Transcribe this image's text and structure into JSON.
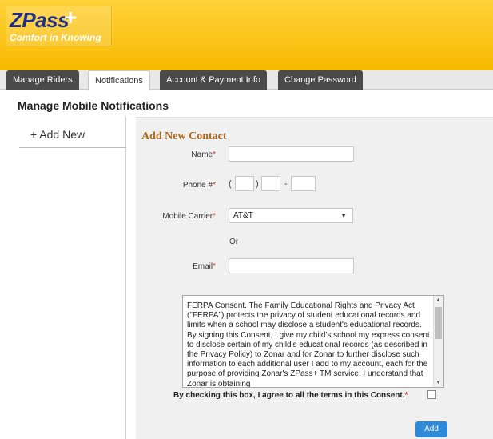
{
  "brand": {
    "name": "ZPass",
    "plus": "+",
    "tagline": "Comfort in Knowing",
    "header_color": "#f7b900"
  },
  "tabs": [
    {
      "label": "Manage Riders"
    },
    {
      "label": "Notifications"
    },
    {
      "label": "Account & Payment Info"
    },
    {
      "label": "Change Password"
    }
  ],
  "active_tab": "Notifications",
  "page_title": "Manage Mobile Notifications",
  "sidebar": {
    "add_new": "+ Add New"
  },
  "form": {
    "title": "Add New Contact",
    "name_label": "Name",
    "required_mark": "*",
    "name_value": "",
    "phone_label": "Phone #",
    "phone_open_paren": "(",
    "phone_close_paren": ")",
    "phone_dash": "-",
    "phone_area": "",
    "phone_prefix": "",
    "phone_line": "",
    "carrier_label": "Mobile Carrier",
    "carrier_selected": "AT&T",
    "or_text": "Or",
    "email_label": "Email",
    "email_value": "",
    "consent_text": "FERPA Consent. The Family Educational Rights and Privacy Act (\"FERPA\") protects the privacy of student educational records and limits when a school may disclose a student's educational records. By signing this Consent, I give my child's school my express consent to disclose certain of my child's educational records (as described in the Privacy Policy) to Zonar and for Zonar to further disclose such information to each additional user I add to my account, each for the purpose of providing Zonar's ZPass+ TM service. I understand that Zonar is obtaining",
    "agree_text": "By checking this box, I agree to all the terms in this Consent.",
    "agree_checked": false,
    "add_button": "Add"
  }
}
